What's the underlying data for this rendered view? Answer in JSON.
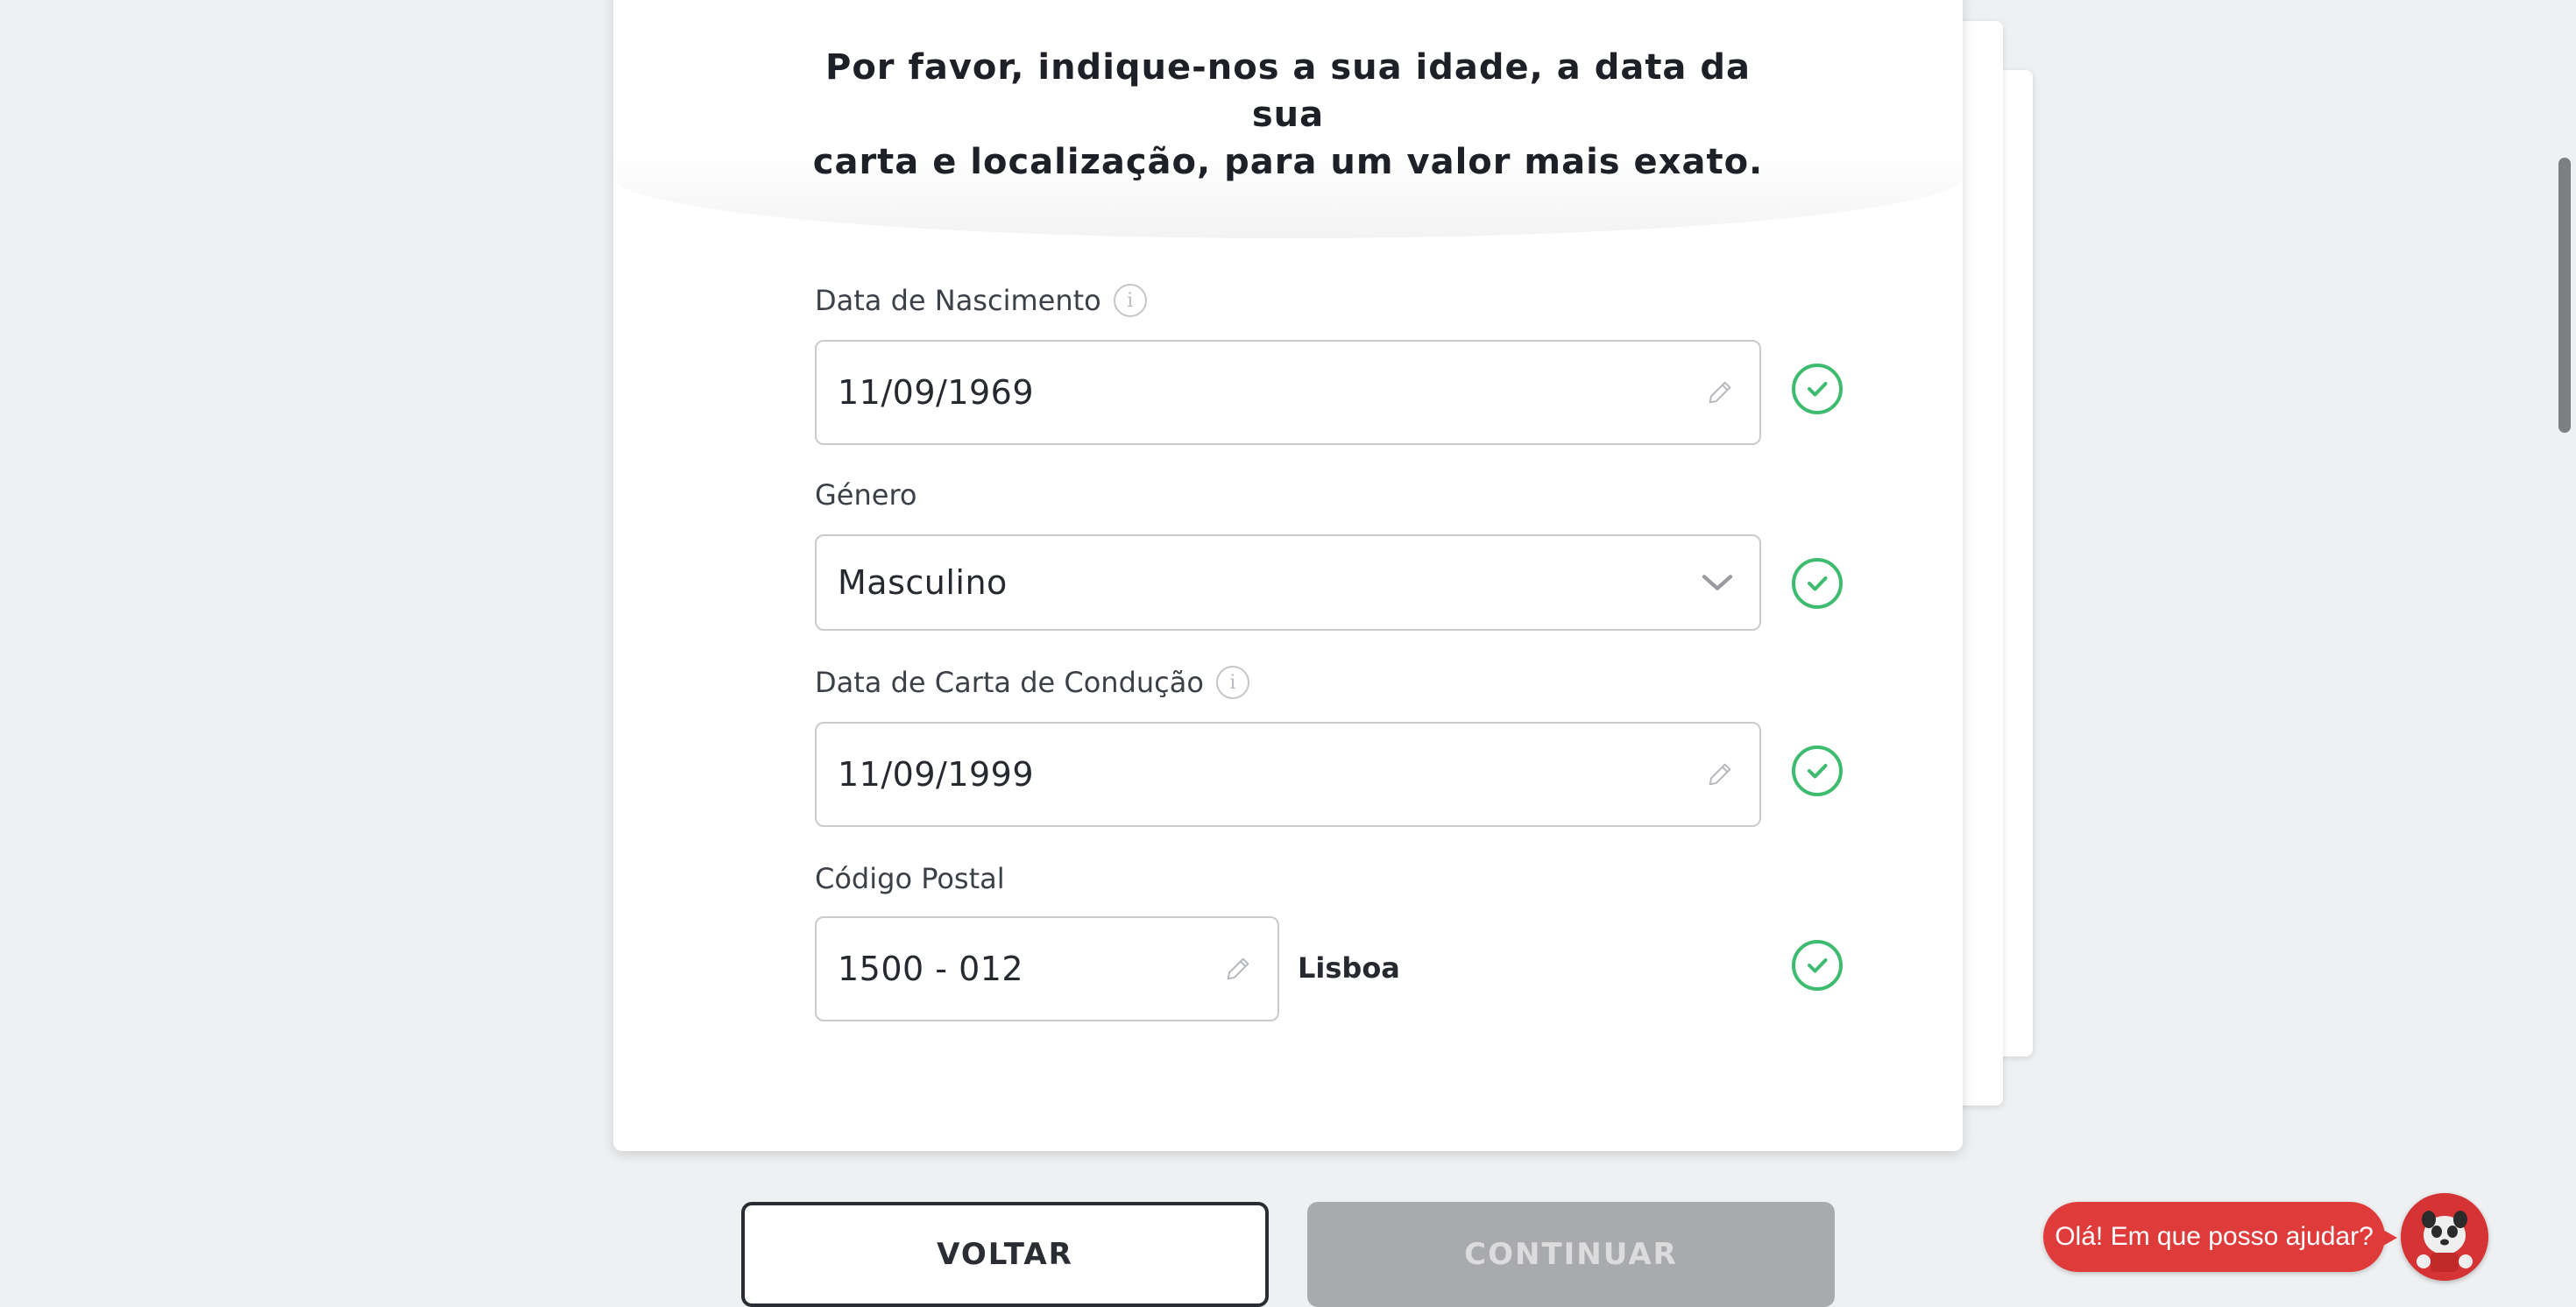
{
  "header": {
    "title_line1": "Por favor, indique-nos a sua idade, a data da sua",
    "title_line2": "carta e localização, para um valor mais exato."
  },
  "fields": {
    "birth_date": {
      "label": "Data de Nascimento",
      "value": "11/09/1969"
    },
    "gender": {
      "label": "Género",
      "value": "Masculino"
    },
    "license_date": {
      "label": "Data de Carta de Condução",
      "value": "11/09/1999"
    },
    "postal_code": {
      "label": "Código Postal",
      "value": "1500 - 012",
      "city": "Lisboa"
    }
  },
  "buttons": {
    "back": "VOLTAR",
    "continue": "CONTINUAR"
  },
  "chat": {
    "greeting": "Olá! Em que posso ajudar?"
  },
  "colors": {
    "check": "#3dbb6e",
    "chat": "#e03b3b",
    "continue_disabled": "#a9aaad"
  },
  "icons": {
    "info": "info-icon",
    "edit": "pencil-icon",
    "valid": "check-circle-icon",
    "dropdown": "chevron-down-icon"
  }
}
